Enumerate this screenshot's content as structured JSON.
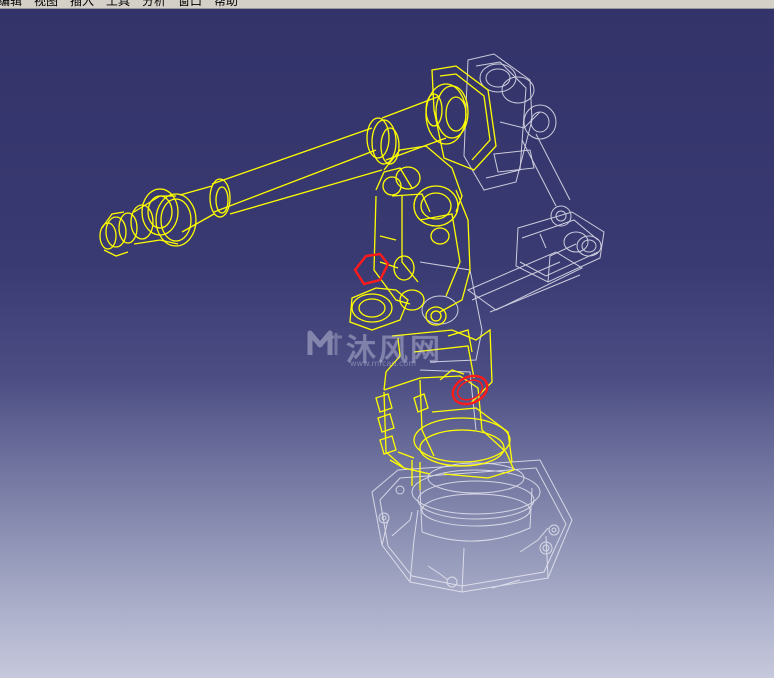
{
  "menubar": {
    "items": [
      "编辑",
      "视图",
      "插入",
      "工具",
      "分析",
      "窗口",
      "帮助"
    ]
  },
  "viewport": {
    "model": "industrial-robot-arm-wireframe",
    "background_top": "#33336a",
    "background_bottom": "#c6c9dc",
    "selected_color": "#ffff00",
    "highlight_color": "#ff0000",
    "unselected_color": "#e6e6f0"
  },
  "watermark": {
    "logo": "mfcad-logo",
    "text": "沐风网",
    "url": "www.mfcad.com"
  }
}
